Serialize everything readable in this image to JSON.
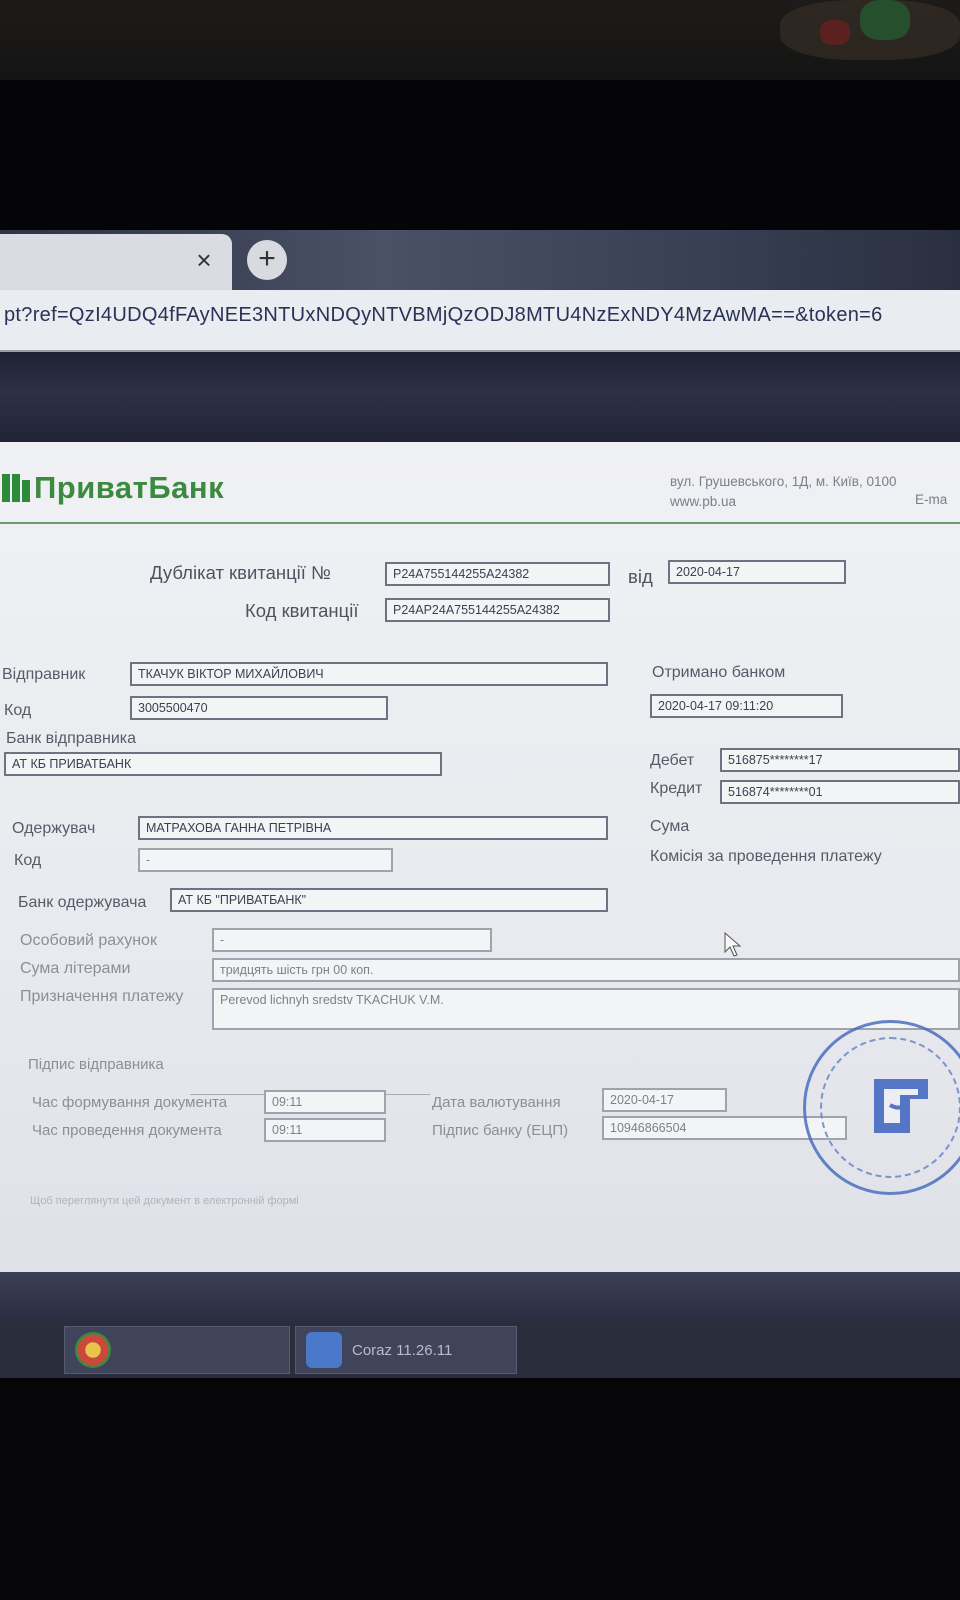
{
  "browser": {
    "tab_close_glyph": "×",
    "newtab_glyph": "+",
    "url": "pt?ref=QzI4UDQ4fFAyNEE3NTUxNDQyNTVBMjQzODJ8MTU4NzExNDY4MzAwMA==&token=6"
  },
  "header": {
    "logo_text": "ПриватБанк",
    "address_line": "вул. Грушевського, 1Д, м. Київ, 0100",
    "website": "www.pb.ua",
    "email_label": "E-ma"
  },
  "receipt": {
    "duplicate_label": "Дублікат квитанції №",
    "duplicate_number": "P24A755144255A24382",
    "from_label": "від",
    "date": "2020-04-17",
    "code_label": "Код квитанції",
    "code_value": "P24AP24A755144255A24382"
  },
  "sender": {
    "label": "Відправник",
    "name": "ТКАЧУК ВІКТОР МИХАЙЛОВИЧ",
    "code_label": "Код",
    "code": "3005500470",
    "bank_label": "Банк відправника",
    "bank": "АТ КБ ПРИВАТБАНК"
  },
  "bank_info": {
    "received_label": "Отримано банком",
    "received_value": "2020-04-17 09:11:20",
    "debit_label": "Дебет",
    "debit_value": "516875********17",
    "credit_label": "Кредит",
    "credit_value": "516874********01",
    "sum_label": "Сума",
    "commission_label": "Комісія за проведення платежу"
  },
  "recipient": {
    "label": "Одержувач",
    "name": "МАТРАХОВА ГАННА ПЕТРІВНА",
    "code_label": "Код",
    "code": "-",
    "bank_label": "Банк одержувача",
    "bank": "АТ КБ \"ПРИВАТБАНК\""
  },
  "payment": {
    "account_label": "Особовий рахунок",
    "account": "-",
    "amount_words_label": "Сума літерами",
    "amount_words": "тридцять шість грн 00 коп.",
    "purpose_label": "Призначення платежу",
    "purpose": "Perevod lichnyh sredstv TKACHUK V.M."
  },
  "signature": {
    "sender_sig_label": "Підпис відправника",
    "formed_label": "Час формування документа",
    "formed_value": "09:11",
    "processed_label": "Час проведення документа",
    "processed_value": "09:11",
    "value_date_label": "Дата валютування",
    "value_date": "2020-04-17",
    "bank_sig_label": "Підпис банку (ЕЦП)",
    "bank_sig_value": "10946866504"
  },
  "footer": {
    "note": "Щоб переглянути цей документ в електронній формі"
  },
  "taskbar": {
    "task1_label": "",
    "task2_label": "Coraz 11.26.11"
  },
  "colors": {
    "brand_green": "#3b8a3f",
    "stamp_blue": "#4b6fc0"
  }
}
